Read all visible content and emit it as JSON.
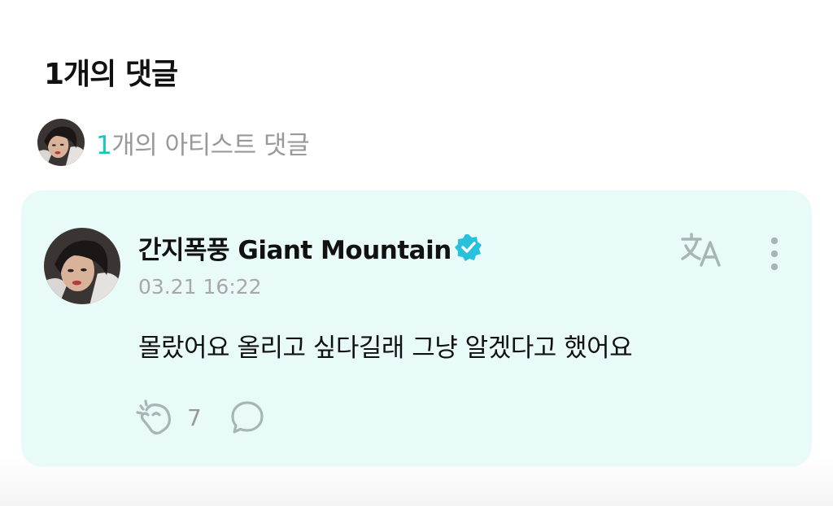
{
  "header": {
    "title": "1개의 댓글"
  },
  "artist_summary": {
    "count": "1",
    "label": "개의 아티스트 댓글",
    "avatar_icon": "artist-avatar"
  },
  "comment": {
    "author": "간지폭풍 Giant Mountain",
    "verified_icon": "verified-check-icon",
    "date": "03.21 16:22",
    "text": "몰랐어요 올리고 싶다길래 그냥 알겠다고 했어요",
    "like_count": "7",
    "translate_icon": "translate-icon",
    "more_icon": "more-vertical-icon",
    "like_icon": "cheer-hand-icon",
    "reply_icon": "speech-bubble-icon"
  },
  "colors": {
    "accent": "#16c6bd",
    "card_background": "#e9fbf8",
    "verified": "#27c1dd",
    "icon_gray": "#a7b6b4"
  }
}
